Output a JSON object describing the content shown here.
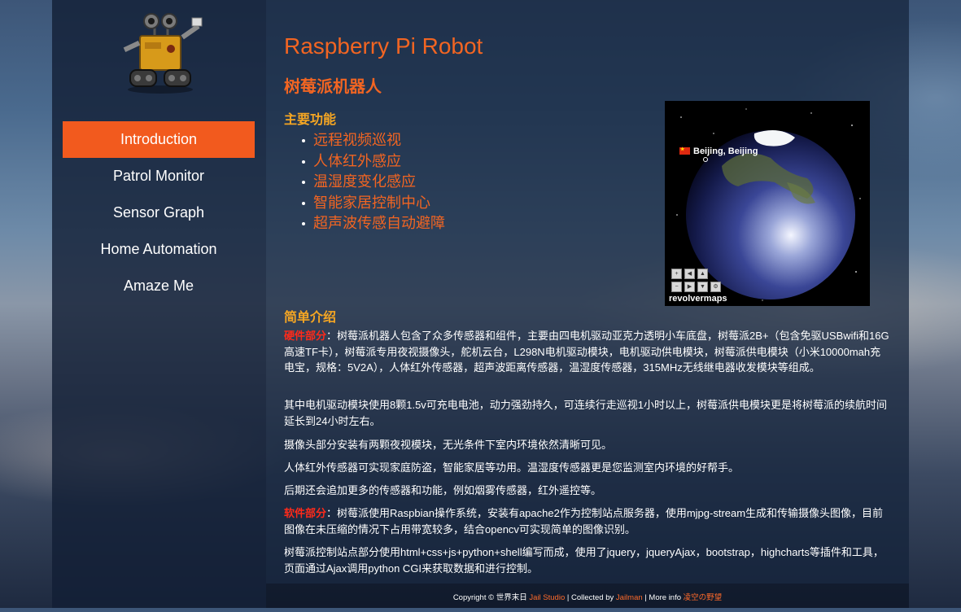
{
  "nav": {
    "items": [
      {
        "label": "Introduction",
        "active": true
      },
      {
        "label": "Patrol Monitor",
        "active": false
      },
      {
        "label": "Sensor Graph",
        "active": false
      },
      {
        "label": "Home Automation",
        "active": false
      },
      {
        "label": "Amaze Me",
        "active": false
      }
    ]
  },
  "header": {
    "title": "Raspberry Pi Robot",
    "subtitle": "树莓派机器人"
  },
  "features": {
    "heading": "主要功能",
    "items": [
      "远程视频巡视",
      "人体红外感应",
      "温湿度变化感应",
      "智能家居控制中心",
      "超声波传感自动避障"
    ]
  },
  "globe_widget": {
    "location_label": "Beijing, Beijing",
    "brand": "revolvermaps",
    "icons": [
      "zoom-in-icon",
      "arrow-left-icon",
      "arrow-up-icon",
      "zoom-out-icon",
      "arrow-right-icon",
      "arrow-down-icon",
      "settings-icon"
    ]
  },
  "intro": {
    "heading": "简单介绍",
    "hardware_tag": "硬件部分",
    "hardware_text": "：树莓派机器人包含了众多传感器和组件，主要由四电机驱动亚克力透明小车底盘，树莓派2B+（包含免驱USBwifi和16G高速TF卡），树莓派专用夜视摄像头，舵机云台，L298N电机驱动模块，电机驱动供电模块，树莓派供电模块（小米10000mah充电宝，规格：5V2A），人体红外传感器，超声波距离传感器，温湿度传感器，315MHz无线继电器收发模块等组成。",
    "p2": "其中电机驱动模块使用8颗1.5v可充电电池，动力强劲持久，可连续行走巡视1小时以上，树莓派供电模块更是将树莓派的续航时间延长到24小时左右。",
    "p3": "摄像头部分安装有两颗夜视模块，无光条件下室内环境依然清晰可见。",
    "p4": "人体红外传感器可实现家庭防盗，智能家居等功用。温湿度传感器更是您监测室内环境的好帮手。",
    "p5": "后期还会追加更多的传感器和功能，例如烟雾传感器，红外遥控等。",
    "software_tag": "软件部分",
    "software_text": "：树莓派使用Raspbian操作系统，安装有apache2作为控制站点服务器，使用mjpg-stream生成和传输摄像头图像，目前图像在未压缩的情况下占用带宽较多，结合opencv可实现简单的图像识别。",
    "p7": "树莓派控制站点部分使用html+css+js+python+shell编写而成，使用了jquery，jqueryAjax，bootstrap，highcharts等插件和工具，页面通过Ajax调用python CGI来获取数据和进行控制。"
  },
  "footer": {
    "copyright": "Copyright © 世界末日",
    "studio": "Jail Studio",
    "sep1": "| Collected by",
    "collector": "Jailman",
    "sep2": "| More info",
    "more": "凌空の野望"
  },
  "colors": {
    "accent": "#f25a1e",
    "title": "#f26522",
    "section_heading": "#f5a623",
    "highlight": "#ff2a1a"
  }
}
